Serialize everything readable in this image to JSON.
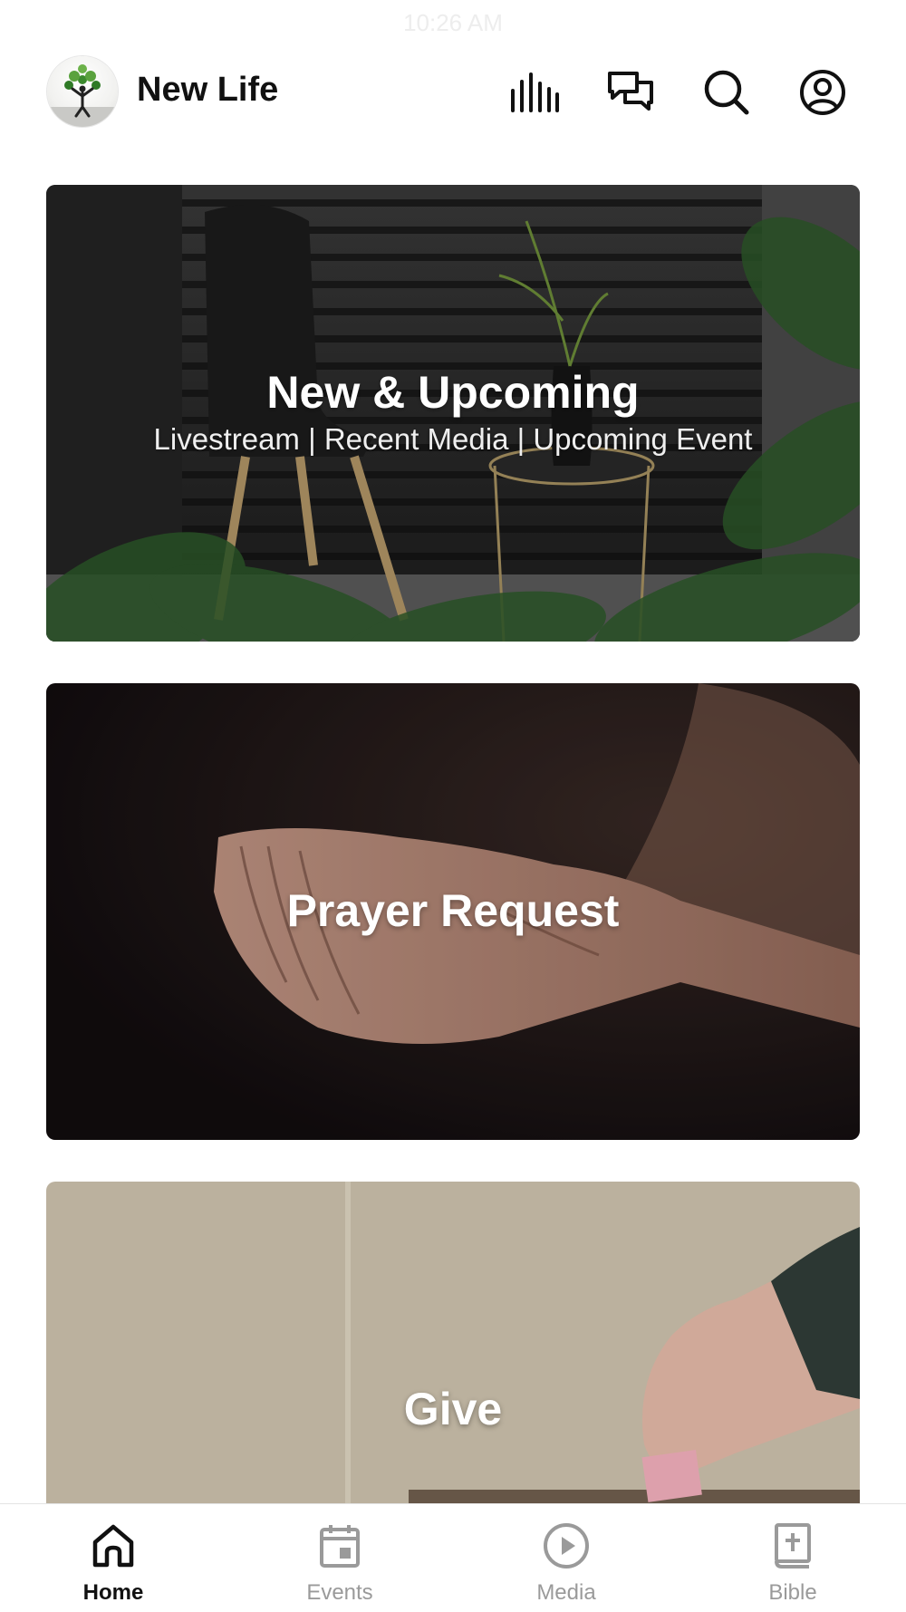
{
  "status_bar": {
    "time": "10:26 AM"
  },
  "header": {
    "app_name": "New Life",
    "logo_icon": "tree-person-logo",
    "actions": [
      {
        "name": "audio-bars-icon"
      },
      {
        "name": "chat-bubbles-icon"
      },
      {
        "name": "search-icon"
      },
      {
        "name": "profile-icon"
      }
    ]
  },
  "cards": [
    {
      "title": "New & Upcoming",
      "subtitle": "Livestream | Recent Media | Upcoming Event"
    },
    {
      "title": "Prayer Request"
    },
    {
      "title": "Give"
    }
  ],
  "tabs": [
    {
      "label": "Home",
      "icon": "home-icon",
      "active": true
    },
    {
      "label": "Events",
      "icon": "calendar-icon",
      "active": false
    },
    {
      "label": "Media",
      "icon": "play-circle-icon",
      "active": false
    },
    {
      "label": "Bible",
      "icon": "bible-icon",
      "active": false
    }
  ],
  "colors": {
    "active_tab": "#111111",
    "inactive_tab": "#9a9a9a",
    "accent_green": "#3c8a2e"
  }
}
